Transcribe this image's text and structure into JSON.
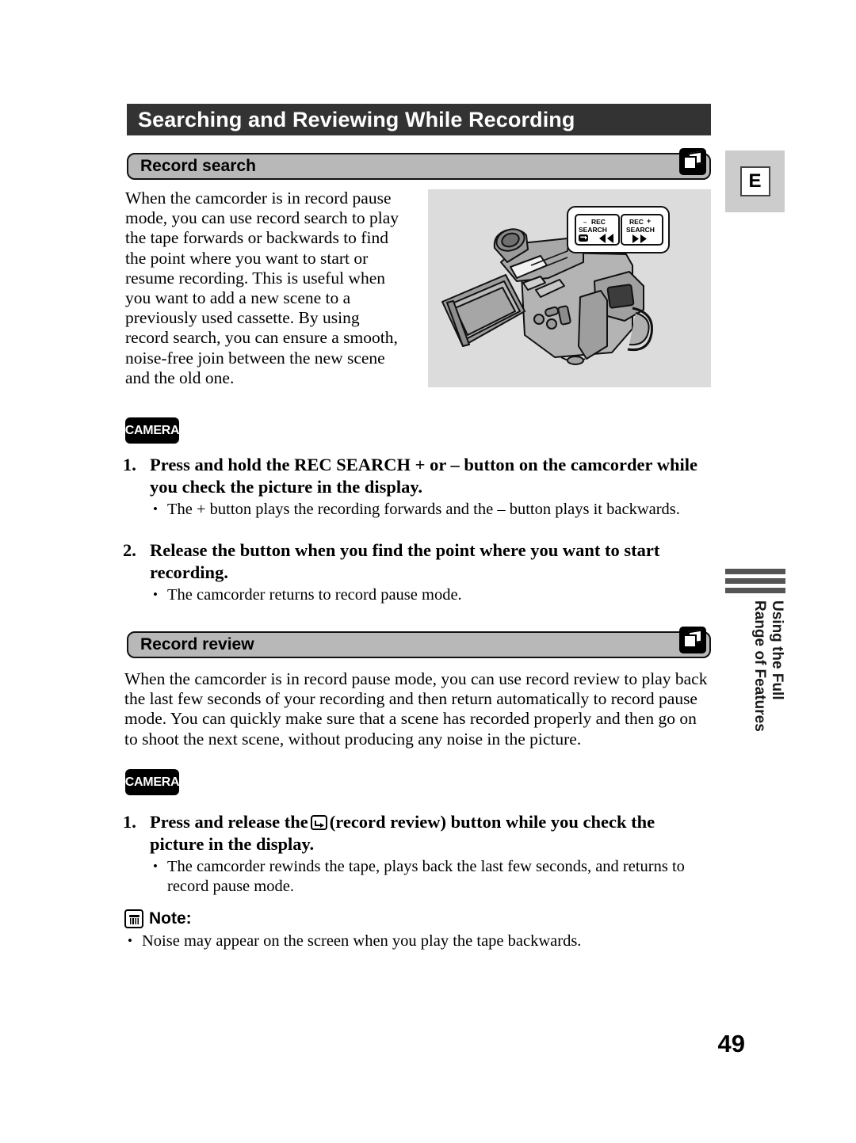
{
  "page": {
    "title": "Searching and Reviewing While Recording",
    "language_badge": "E",
    "number": "49"
  },
  "side_tab": {
    "line1": "Using the Full",
    "line2": "Range of Features"
  },
  "sections": [
    {
      "id": "record-search",
      "heading": "Record search",
      "icon": "cassette-icon",
      "intro": "When the camcorder is in record pause mode, you can use record search to play the tape forwards or backwards to find the point where you want to start or resume recording. This is useful when you want to add a new scene to a previously used cassette. By using record search, you can ensure a smooth, noise-free join between the new scene and the old one.",
      "mode_badge": "CAMERA",
      "steps": [
        {
          "number": "1.",
          "heading": "Press and hold the REC SEARCH + or – button on the camcorder while you check the picture in the display.",
          "bullets": [
            "The + button plays the recording forwards and the – button plays it backwards."
          ]
        },
        {
          "number": "2.",
          "heading": "Release the button when you find the point where you want to start recording.",
          "bullets": [
            "The camcorder returns to record pause mode."
          ]
        }
      ]
    },
    {
      "id": "record-review",
      "heading": "Record review",
      "icon": "cassette-icon",
      "intro": "When the camcorder is in record pause mode, you can use record review to play back the last few seconds of your recording and then return automatically to record pause mode. You can quickly make sure that a scene has recorded properly and then go on to shoot the next scene, without producing any noise in the picture.",
      "mode_badge": "CAMERA",
      "steps": [
        {
          "number": "1.",
          "heading_before_glyph": "Press and release the",
          "heading_after_glyph": "(record review) button while you check the picture in the display.",
          "bullets": [
            "The camcorder rewinds the tape, plays back the last few seconds, and returns to record pause mode."
          ]
        }
      ]
    }
  ],
  "illustration": {
    "alt": "camcorder-with-rec-search-callout",
    "callout_buttons": [
      {
        "minus": "–",
        "line1": "REC",
        "line2": "SEARCH",
        "glyph": "rewind-double-arrow"
      },
      {
        "plus": "+",
        "line1": "REC",
        "line2": "SEARCH",
        "glyph": "forward-double-arrow"
      }
    ]
  },
  "note": {
    "icon": "note-icon",
    "label": "Note:",
    "bullets": [
      "Noise may appear on the screen when you play the tape backwards."
    ]
  }
}
